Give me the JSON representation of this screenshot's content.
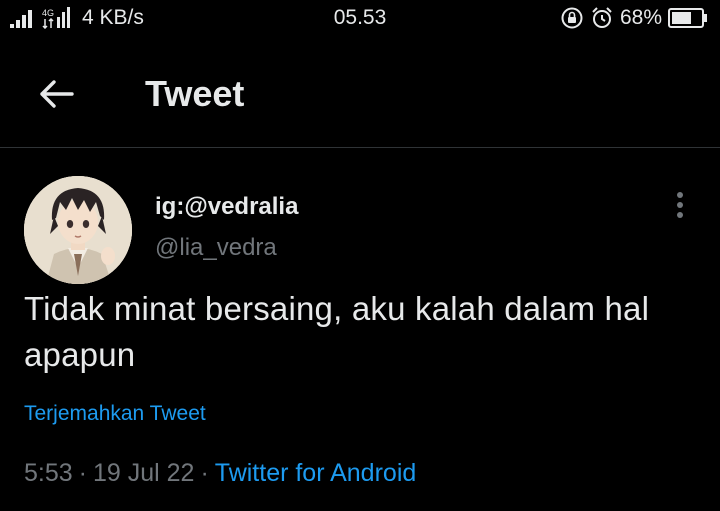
{
  "status_bar": {
    "network_type": "4G",
    "speed": "4 KB/s",
    "time": "05.53",
    "battery_percent": "68%",
    "battery_level": 0.68
  },
  "header": {
    "back_icon": "arrow-left-icon",
    "title": "Tweet"
  },
  "tweet": {
    "display_name": "ig:@vedralia",
    "handle": "@lia_vedra",
    "text": "Tidak minat bersaing, aku kalah dalam hal apapun",
    "translate_label": "Terjemahkan Tweet",
    "time": "5:53",
    "date": "19 Jul 22",
    "separator": "·",
    "source": "Twitter for Android",
    "more_icon": "more-vertical-icon"
  },
  "colors": {
    "background": "#000000",
    "text_primary": "#e7e9ea",
    "text_secondary": "#71767b",
    "accent": "#1d9bf0",
    "divider": "#2f3336"
  }
}
